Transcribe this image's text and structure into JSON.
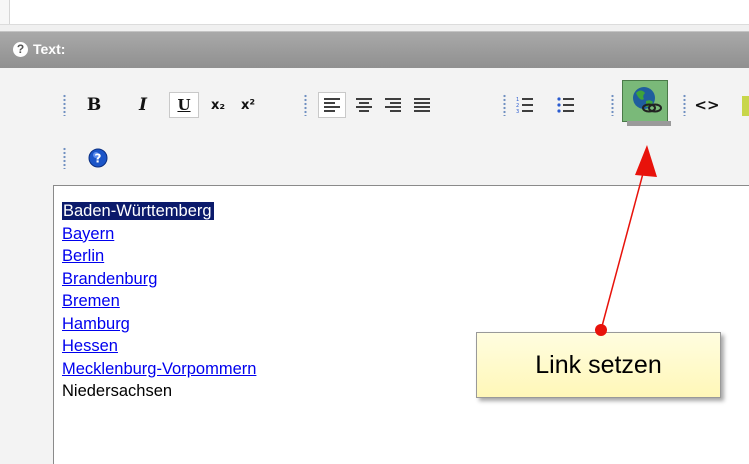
{
  "section": {
    "help_glyph": "?",
    "title": "Text:"
  },
  "toolbar": {
    "bold": "B",
    "italic": "I",
    "underline": "U",
    "subscript": "x₂",
    "superscript": "x²",
    "source": "<>"
  },
  "content": {
    "items": [
      {
        "label": "Baden-Württemberg",
        "selected": true
      },
      {
        "label": "Bayern"
      },
      {
        "label": "Berlin"
      },
      {
        "label": "Brandenburg"
      },
      {
        "label": "Bremen"
      },
      {
        "label": "Hamburg"
      },
      {
        "label": "Hessen"
      },
      {
        "label": "Mecklenburg-Vorpommern"
      },
      {
        "label": "Niedersachsen"
      }
    ]
  },
  "callout": {
    "text": "Link setzen"
  },
  "colors": {
    "link": "#0000ee",
    "selection": "#0b1a6b",
    "tooltip_bg": "#fff7b8",
    "arrow": "#e8120b",
    "link_button": "#7ab979"
  }
}
